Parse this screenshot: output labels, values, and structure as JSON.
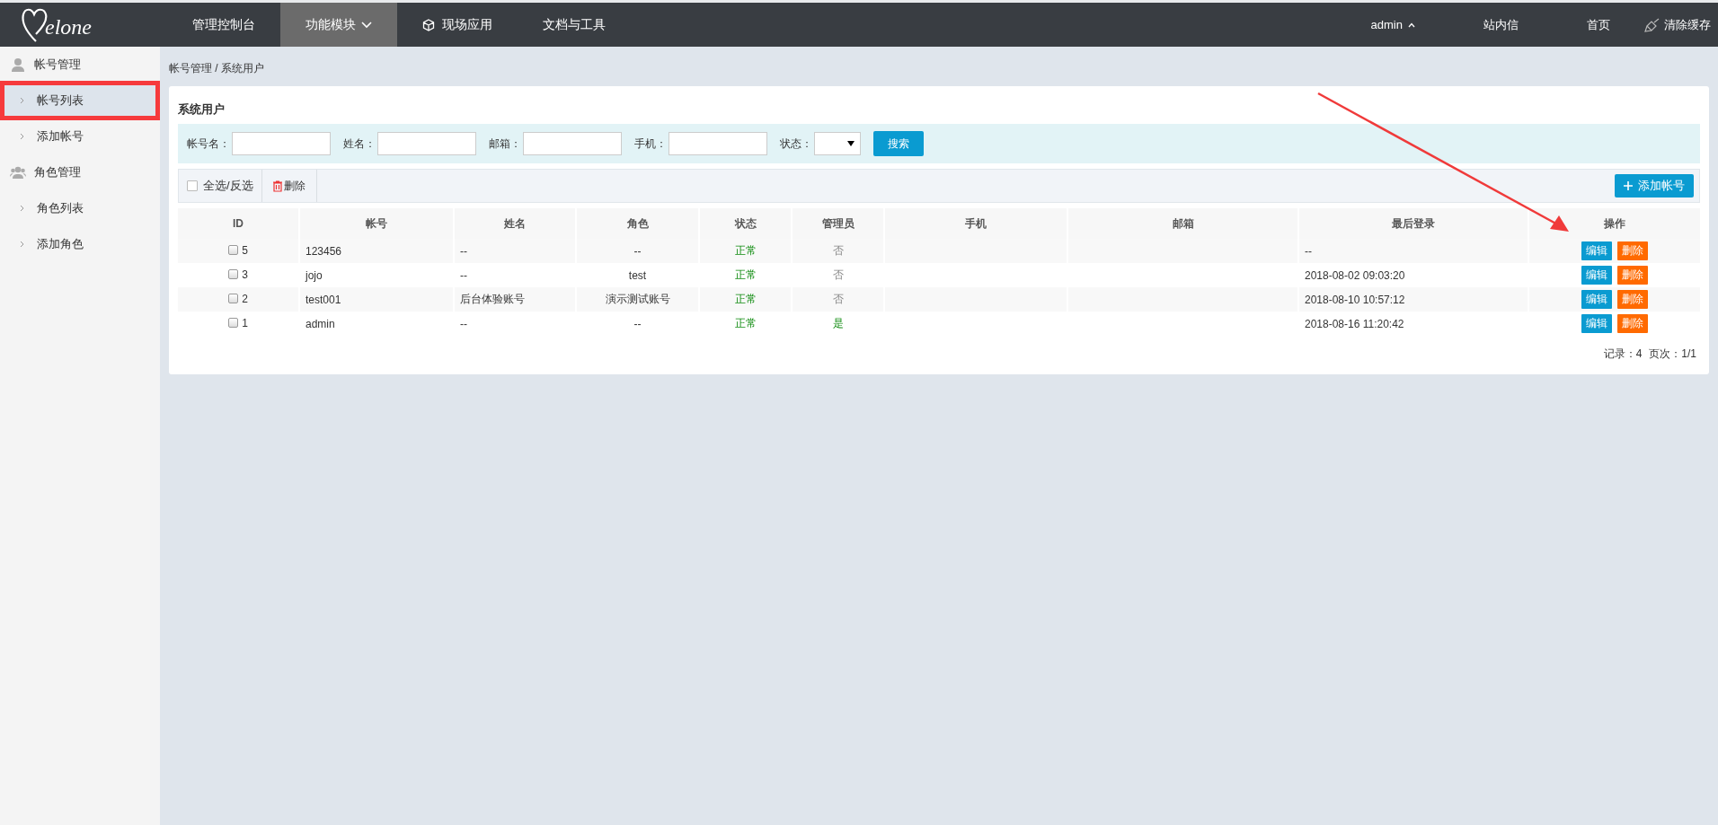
{
  "topbar": {
    "logo_text": "elone",
    "nav": [
      {
        "label": "管理控制台",
        "kind": "plain",
        "selected": false
      },
      {
        "label": "功能模块",
        "kind": "dropdown",
        "selected": true
      },
      {
        "label": "现场应用",
        "kind": "cube",
        "selected": false
      },
      {
        "label": "文档与工具",
        "kind": "plain",
        "selected": false
      }
    ],
    "user": "admin",
    "links": [
      "站内信",
      "首页"
    ],
    "clear_cache": "清除缓存"
  },
  "sidebar": {
    "groups": [
      {
        "title": "帐号管理",
        "kind": "person",
        "items": [
          {
            "label": "帐号列表",
            "selected": true
          },
          {
            "label": "添加帐号",
            "selected": false
          }
        ]
      },
      {
        "title": "角色管理",
        "kind": "group",
        "items": [
          {
            "label": "角色列表",
            "selected": false
          },
          {
            "label": "添加角色",
            "selected": false
          }
        ]
      }
    ]
  },
  "breadcrumb": "帐号管理 / 系统用户",
  "panel": {
    "title": "系统用户",
    "filters": [
      {
        "label": "帐号名：",
        "kind": "text"
      },
      {
        "label": "姓名：",
        "kind": "text"
      },
      {
        "label": "邮箱：",
        "kind": "text"
      },
      {
        "label": "手机：",
        "kind": "text"
      },
      {
        "label": "状态：",
        "kind": "select"
      }
    ],
    "search_button": "搜索",
    "select_all": {
      "label": "全选/反选",
      "checked": false
    },
    "delete_button": "删除",
    "add_button": "添加帐号",
    "table": {
      "columns": [
        "ID",
        "帐号",
        "姓名",
        "角色",
        "状态",
        "管理员",
        "手机",
        "邮箱",
        "最后登录",
        "操作"
      ],
      "rows": [
        {
          "checked": false,
          "id": "5",
          "account": "123456",
          "name": "--",
          "role": "--",
          "status": "正常",
          "admin": "否",
          "is_admin": false,
          "phone": "",
          "email": "",
          "last_login": "--",
          "actions": [
            "编辑",
            "删除"
          ]
        },
        {
          "checked": false,
          "id": "3",
          "account": "jojo",
          "name": "--",
          "role": "test",
          "status": "正常",
          "admin": "否",
          "is_admin": false,
          "phone": "",
          "email": "",
          "last_login": "2018-08-02 09:03:20",
          "actions": [
            "编辑",
            "删除"
          ]
        },
        {
          "checked": false,
          "id": "2",
          "account": "test001",
          "name": "后台体验账号",
          "role": "演示测试账号",
          "status": "正常",
          "admin": "否",
          "is_admin": false,
          "phone": "",
          "email": "",
          "last_login": "2018-08-10 10:57:12",
          "actions": [
            "编辑",
            "删除"
          ]
        },
        {
          "checked": false,
          "id": "1",
          "account": "admin",
          "name": "--",
          "role": "--",
          "status": "正常",
          "admin": "是",
          "is_admin": true,
          "phone": "",
          "email": "",
          "last_login": "2018-08-16 11:20:42",
          "actions": [
            "编辑",
            "删除"
          ]
        }
      ]
    },
    "pagination": {
      "records": "记录：4",
      "pages": "页次：1/1"
    }
  }
}
